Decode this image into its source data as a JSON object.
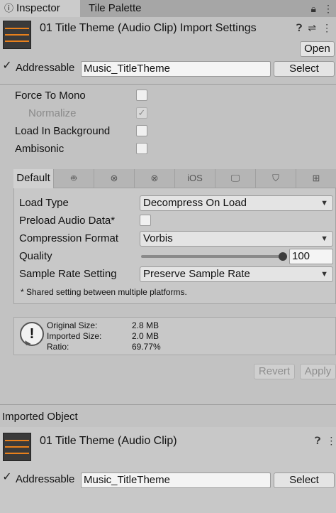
{
  "tabs": {
    "inspector": "Inspector",
    "tile_palette": "Tile Palette",
    "inspector_icon": "info-icon",
    "lock_icon": "lock-icon",
    "menu_icon": "kebab-menu-icon"
  },
  "header": {
    "title": "01 Title Theme (Audio Clip) Import Settings",
    "help_icon": "help-icon",
    "settings_icon": "sliders-icon",
    "menu_icon": "kebab-menu-icon",
    "open_label": "Open",
    "addressable_label": "Addressable",
    "addressable_checked": true,
    "address_value": "Music_TitleTheme",
    "select_label": "Select"
  },
  "options": {
    "force_to_mono": "Force To Mono",
    "force_to_mono_checked": false,
    "normalize": "Normalize",
    "normalize_checked": true,
    "load_in_background": "Load In Background",
    "load_in_background_checked": false,
    "ambisonic": "Ambisonic",
    "ambisonic_checked": false
  },
  "platform_tabs": {
    "default": "Default",
    "android_icon": "android-icon",
    "xbox_icon": "xbox-icon",
    "xbox_series_icon": "xbox-icon",
    "ios": "iOS",
    "standalone_icon": "monitor-icon",
    "webgl_icon": "html5-icon",
    "windows_icon": "windows-icon"
  },
  "settings": {
    "load_type_label": "Load Type",
    "load_type_value": "Decompress On Load",
    "preload_label": "Preload Audio Data*",
    "preload_checked": false,
    "compression_label": "Compression Format",
    "compression_value": "Vorbis",
    "quality_label": "Quality",
    "quality_value": "100",
    "quality_fraction": 1.0,
    "sample_rate_label": "Sample Rate Setting",
    "sample_rate_value": "Preserve Sample Rate",
    "shared_note": "* Shared setting between multiple platforms."
  },
  "info": {
    "original_size_label": "Original Size:",
    "original_size_value": "2.8 MB",
    "imported_size_label": "Imported Size:",
    "imported_size_value": "2.0 MB",
    "ratio_label": "Ratio:",
    "ratio_value": "69.77%"
  },
  "actions": {
    "revert": "Revert",
    "apply": "Apply"
  },
  "imported": {
    "section_title": "Imported Object",
    "title": "01 Title Theme (Audio Clip)",
    "help_icon": "help-icon",
    "menu_icon": "kebab-menu-icon",
    "addressable_label": "Addressable",
    "addressable_checked": true,
    "address_value": "Music_TitleTheme",
    "select_label": "Select"
  },
  "colors": {
    "panel": "#c2c2c2",
    "waveform": "#e8801c",
    "clip_icon_bg": "#3a3a3a"
  }
}
